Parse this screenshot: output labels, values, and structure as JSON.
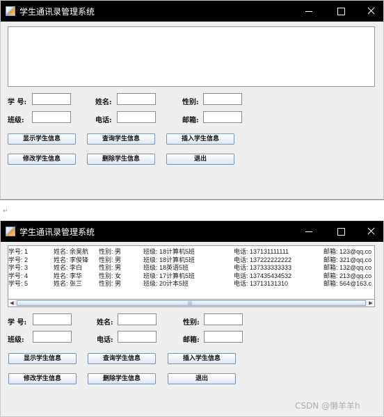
{
  "window": {
    "title": "学生通讯录管理系统",
    "controls": {
      "minimize_icon": "minimize-icon",
      "maximize_icon": "maximize-icon",
      "close_icon": "close-icon"
    }
  },
  "form": {
    "labels": {
      "id": "学  号:",
      "name": "姓名:",
      "gender": "性别:",
      "class": "班级:",
      "phone": "电话:",
      "email": "邮箱:"
    },
    "values": {
      "id": "",
      "name": "",
      "gender": "",
      "class": "",
      "phone": "",
      "email": ""
    }
  },
  "buttons": {
    "show": "显示学生信息",
    "query": "查询学生信息",
    "insert": "插入学生信息",
    "modify": "修改学生信息",
    "delete": "删除学生信息",
    "exit": "退出"
  },
  "paragraph_mark": "↵",
  "records": [
    {
      "id": "学号: 1",
      "name": "姓名: 余昊航",
      "gender": "性别: 男",
      "class": "班级: 18计算机5班",
      "phone": "电话: 137131111111",
      "email": "邮箱: 123@qq.co"
    },
    {
      "id": "学号: 2",
      "name": "姓名: 李俊锋",
      "gender": "性别: 男",
      "class": "班级: 18计算机5班",
      "phone": "电话: 137222222222",
      "email": "邮箱: 321@qq.co"
    },
    {
      "id": "学号: 3",
      "name": "姓名: 李白",
      "gender": "性别: 男",
      "class": "班级: 18英语5班",
      "phone": "电话: 137333333333",
      "email": "邮箱: 132@qq.co"
    },
    {
      "id": "学号: 4",
      "name": "姓名: 李华",
      "gender": "性别: 女",
      "class": "班级: 17计算机5班",
      "phone": "电话: 137435434532",
      "email": "邮箱: 213@qq.co"
    },
    {
      "id": "学号: 5",
      "name": "姓名: 张三",
      "gender": "性别: 男",
      "class": "班级: 20计本5班",
      "phone": "电话: 13713131310",
      "email": "邮箱: 564@163.c"
    }
  ],
  "watermark": "CSDN @懒羊羊h"
}
